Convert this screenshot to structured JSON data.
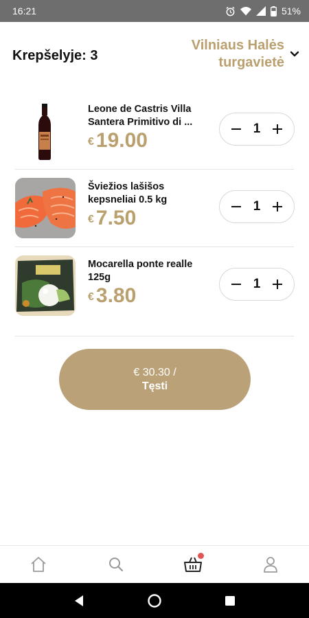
{
  "status_bar": {
    "time": "16:21",
    "battery": "51%"
  },
  "header": {
    "cart_count_label": "Krepšelyje: 3",
    "market_name": "Vilniaus Halės turgavietė"
  },
  "items": [
    {
      "name": "Leone de Castris Villa Santera Primitivo di ...",
      "currency": "€",
      "price": "19.00",
      "quantity": "1",
      "image": "wine-bottle"
    },
    {
      "name": "Šviežios lašišos kepsneliai 0.5 kg",
      "currency": "€",
      "price": "7.50",
      "quantity": "1",
      "image": "salmon-steaks"
    },
    {
      "name": "Mocarella ponte realle 125g",
      "currency": "€",
      "price": "3.80",
      "quantity": "1",
      "image": "mozzarella-package"
    }
  ],
  "checkout": {
    "total": "€ 30.30 /",
    "label": "Tęsti"
  },
  "bottom_nav": [
    "home-icon",
    "search-icon",
    "basket-icon",
    "profile-icon"
  ],
  "colors": {
    "accent": "#b9a06e",
    "button": "#bba177",
    "badge": "#e25555"
  }
}
